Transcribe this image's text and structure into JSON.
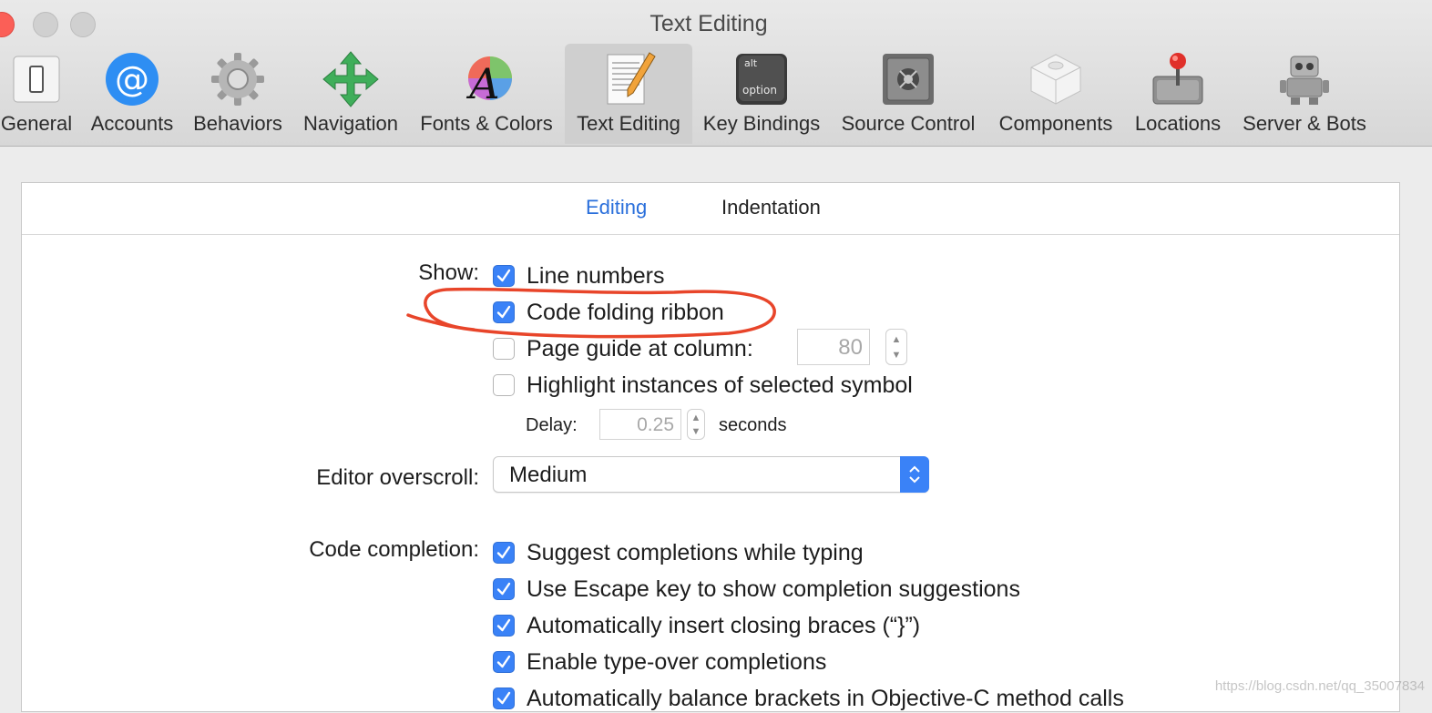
{
  "window": {
    "title": "Text Editing"
  },
  "toolbar": {
    "items": [
      {
        "label": "General",
        "icon": "general-switch-icon"
      },
      {
        "label": "Accounts",
        "icon": "at-sign-icon"
      },
      {
        "label": "Behaviors",
        "icon": "gear-icon"
      },
      {
        "label": "Navigation",
        "icon": "navigation-arrows-icon"
      },
      {
        "label": "Fonts & Colors",
        "icon": "font-color-wheel-icon"
      },
      {
        "label": "Text Editing",
        "icon": "document-pencil-icon",
        "selected": true
      },
      {
        "label": "Key Bindings",
        "icon": "option-key-icon",
        "key_top": "alt",
        "key_bottom": "option"
      },
      {
        "label": "Source Control",
        "icon": "safe-vault-icon"
      },
      {
        "label": "Components",
        "icon": "components-cube-icon"
      },
      {
        "label": "Locations",
        "icon": "drive-joystick-icon"
      },
      {
        "label": "Server & Bots",
        "icon": "robot-icon"
      }
    ]
  },
  "tabs": [
    {
      "label": "Editing",
      "active": true
    },
    {
      "label": "Indentation",
      "active": false
    }
  ],
  "show": {
    "label": "Show:",
    "options": [
      {
        "text": "Line numbers",
        "checked": true
      },
      {
        "text": "Code folding ribbon",
        "checked": true
      },
      {
        "text": "Page guide at column:",
        "checked": false
      },
      {
        "text": "Highlight instances of selected symbol",
        "checked": false
      }
    ],
    "page_guide_column": "80",
    "delay_label": "Delay:",
    "delay_value": "0.25",
    "delay_unit": "seconds"
  },
  "overscroll": {
    "label": "Editor overscroll:",
    "value": "Medium"
  },
  "code_completion": {
    "label": "Code completion:",
    "options": [
      {
        "text": "Suggest completions while typing",
        "checked": true
      },
      {
        "text": "Use Escape key to show completion suggestions",
        "checked": true
      },
      {
        "text": "Automatically insert closing braces (“}”)",
        "checked": true
      },
      {
        "text": "Enable type-over completions",
        "checked": true
      },
      {
        "text": "Automatically balance brackets in Objective-C method calls",
        "checked": true
      }
    ]
  },
  "watermark": "https://blog.csdn.net/qq_35007834",
  "colors": {
    "accent": "#3a82f7",
    "annotation": "#e8452a",
    "close": "#fb5f57"
  }
}
